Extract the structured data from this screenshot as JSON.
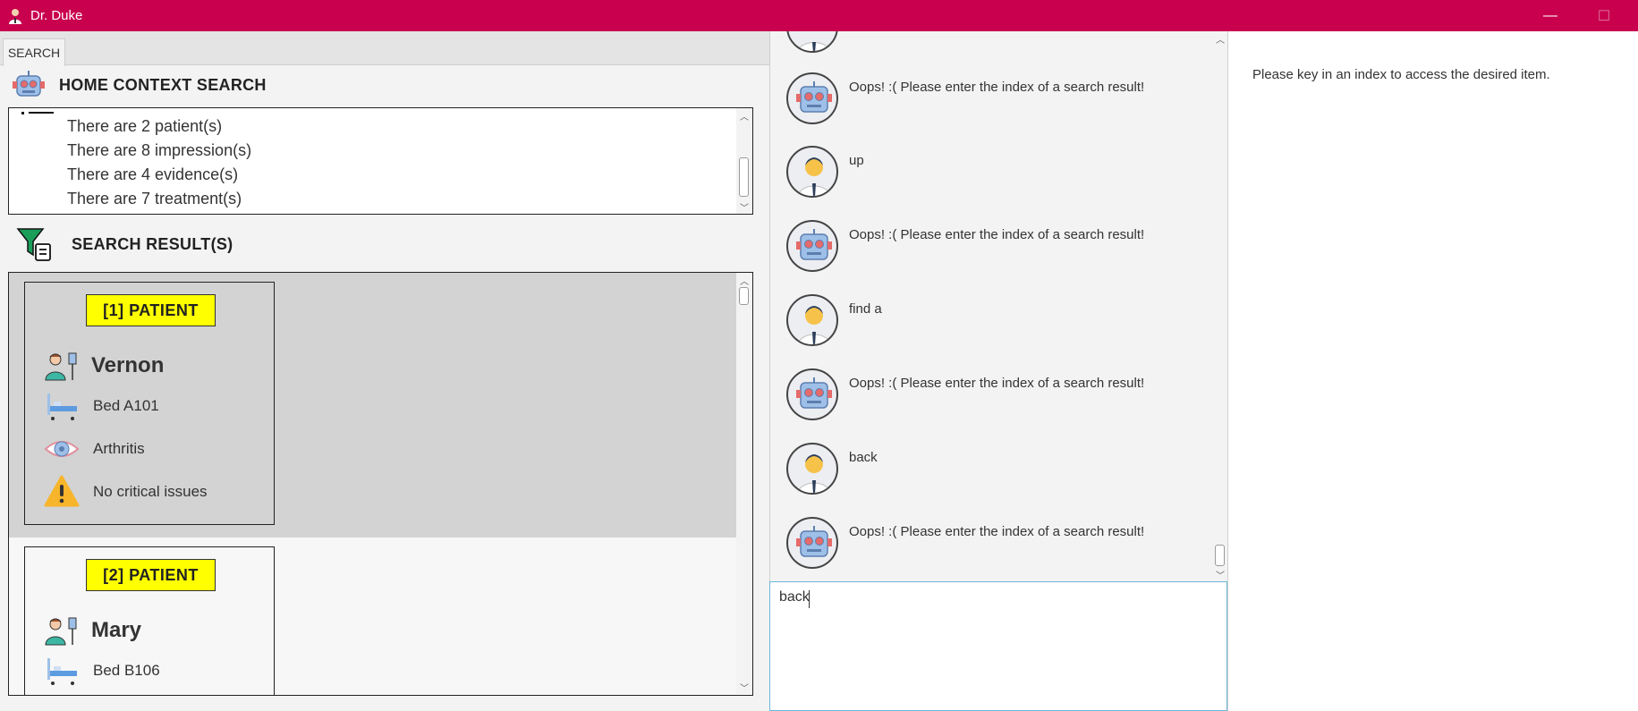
{
  "window": {
    "title": "Dr. Duke",
    "minimize": "—",
    "maximize": "☐"
  },
  "tabs": [
    {
      "label": "SEARCH"
    }
  ],
  "home": {
    "heading": "HOME CONTEXT SEARCH",
    "lines": [
      "There are 2 patient(s)",
      "There are 8 impression(s)",
      "There are 4 evidence(s)",
      "There are 7 treatment(s)"
    ]
  },
  "results": {
    "heading": "SEARCH RESULT(S)",
    "cards": [
      {
        "badge": "[1] PATIENT",
        "name": "Vernon",
        "bed": "Bed A101",
        "condition": "Arthritis",
        "critical": "No critical issues"
      },
      {
        "badge": "[2] PATIENT",
        "name": "Mary",
        "bed": "Bed B106"
      }
    ]
  },
  "chat": {
    "messages": [
      {
        "sender": "bot",
        "text": "Oops! :( Please enter the index of a search result!"
      },
      {
        "sender": "user",
        "text": "up"
      },
      {
        "sender": "bot",
        "text": "Oops! :( Please enter the index of a search result!"
      },
      {
        "sender": "user",
        "text": "find a"
      },
      {
        "sender": "bot",
        "text": "Oops! :( Please enter the index of a search result!"
      },
      {
        "sender": "user",
        "text": "back"
      },
      {
        "sender": "bot",
        "text": "Oops! :( Please enter the index of a search result!"
      }
    ],
    "input_value": "back"
  },
  "detail": {
    "message": "Please key in an index to access the desired item."
  },
  "colors": {
    "titlebar": "#c8004e",
    "badge": "#ffff00",
    "selected_row": "#d3d3d3",
    "input_border": "#6ab8d8"
  },
  "icons": {
    "app": "doctor-icon",
    "home": "robot-icon",
    "results": "filter-icon",
    "patient": "patient-iv-icon",
    "bed": "bed-icon",
    "condition": "eye-icon",
    "critical": "warning-icon"
  }
}
